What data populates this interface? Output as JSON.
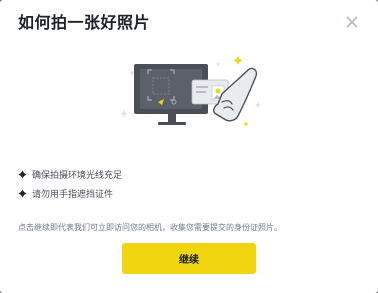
{
  "dialog": {
    "title": "如何拍一张好照片",
    "tips": [
      "确保拍摄环境光线充足",
      "请勿用手指遮挡证件"
    ],
    "notice": "点击继续即代表我们可立即访问您的相机，收集您需要提交的身份证照片。",
    "continue_label": "继续"
  },
  "icons": {
    "close": "close-icon",
    "bullet": "diamond-bullet-icon",
    "illustration": "id-photo-camera-illustration"
  },
  "colors": {
    "accent": "#F0D50F",
    "title": "#1E2329",
    "body_text": "#474D57",
    "muted_text": "#707A8A",
    "illustration_dark": "#4A4E57",
    "illustration_light": "#E9ECEF"
  }
}
